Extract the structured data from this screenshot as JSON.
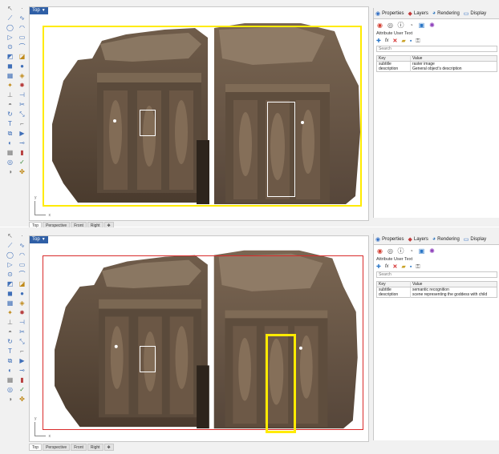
{
  "panels": [
    {
      "id": "top",
      "viewport_title": "Top",
      "view_tabs": [
        "Top",
        "Perspective",
        "Front",
        "Right"
      ],
      "active_tab": 0,
      "axis": {
        "x": "x",
        "y": "y"
      },
      "properties_tabs": [
        {
          "icon": "palette-icon",
          "label": "Properties"
        },
        {
          "icon": "layers-icon",
          "label": "Layers"
        },
        {
          "icon": "rendering-icon",
          "label": "Rendering"
        },
        {
          "icon": "display-icon",
          "label": "Display"
        }
      ],
      "section_title": "Attribute User Text",
      "search_placeholder": "Search",
      "table": {
        "headers": [
          "Key",
          "Value"
        ],
        "rows": [
          [
            "subtitle",
            "raster image"
          ],
          [
            "description",
            "General object's description"
          ]
        ]
      }
    },
    {
      "id": "bottom",
      "viewport_title": "Top",
      "view_tabs": [
        "Top",
        "Perspective",
        "Front",
        "Right"
      ],
      "active_tab": 0,
      "axis": {
        "x": "x",
        "y": "y"
      },
      "properties_tabs": [
        {
          "icon": "palette-icon",
          "label": "Properties"
        },
        {
          "icon": "layers-icon",
          "label": "Layers"
        },
        {
          "icon": "rendering-icon",
          "label": "Rendering"
        },
        {
          "icon": "display-icon",
          "label": "Display"
        }
      ],
      "section_title": "Attribute User Text",
      "search_placeholder": "Search",
      "table": {
        "headers": [
          "Key",
          "Value"
        ],
        "rows": [
          [
            "subtitle",
            "semantic recognition"
          ],
          [
            "description",
            "scene representing the goddess with child"
          ]
        ]
      }
    }
  ],
  "colors": {
    "selection_yellow": "#ffeb00",
    "selection_white": "#ffffff",
    "viewport_border_red": "#d92b2b",
    "title_blue": "#2f5fa6",
    "stone_dark": "#4a3b2e",
    "stone_light": "#8a7560"
  }
}
